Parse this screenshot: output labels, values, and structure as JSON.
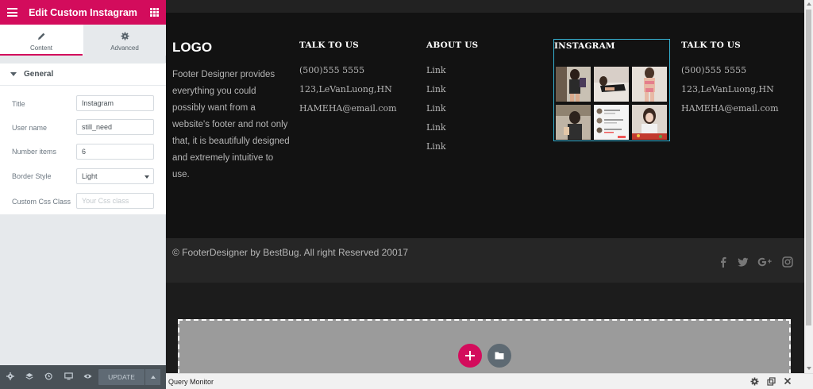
{
  "editor": {
    "title": "Edit Custom Instagram",
    "tabs": [
      {
        "label": "Content",
        "icon": "pencil-icon",
        "active": true
      },
      {
        "label": "Advanced",
        "icon": "gear-icon",
        "active": false
      }
    ],
    "section": "General",
    "controls": {
      "title": {
        "label": "Title",
        "value": "Instagram"
      },
      "username": {
        "label": "User name",
        "value": "still_need"
      },
      "number_items": {
        "label": "Number items",
        "value": "6"
      },
      "border_style": {
        "label": "Border Style",
        "value": "Light"
      },
      "css_class": {
        "label": "Custom Css Class",
        "placeholder": "Your Css class"
      }
    },
    "footer": {
      "update_label": "UPDATE",
      "icons": [
        "settings-icon",
        "layers-icon",
        "history-icon",
        "responsive-icon",
        "preview-eye-icon"
      ]
    },
    "accent_color": "#d30c5c"
  },
  "site_footer": {
    "logo": "LOGO",
    "about": "Footer Designer provides everything you could possibly want from a website's footer and not only that, it is beautifully designed and extremely intuitive to use.",
    "talk1": {
      "heading": "TALK TO US",
      "phone": "(500)555 5555",
      "address": "123,LeVanLuong,HN",
      "email": "HAMEHA@email.com"
    },
    "about_us": {
      "heading": "ABOUT US",
      "links": [
        "Link",
        "Link",
        "Link",
        "Link",
        "Link"
      ]
    },
    "instagram": {
      "heading": "INSTAGRAM",
      "photo_count": 6,
      "border_color": "#36b1d2"
    },
    "talk2": {
      "heading": "TALK TO US",
      "phone": "(500)555 5555",
      "address": "123,LeVanLuong,HN",
      "email": "HAMEHA@email.com"
    },
    "copyright": "© FooterDesigner by BestBug. All right Reserved 20017",
    "social_icons": [
      "facebook-icon",
      "twitter-icon",
      "google-plus-icon",
      "instagram-icon"
    ]
  },
  "query_monitor": {
    "label": "Query Monitor"
  }
}
